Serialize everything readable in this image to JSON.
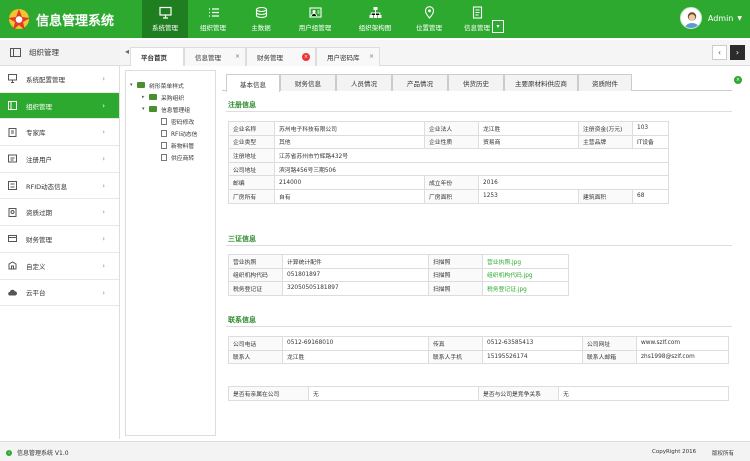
{
  "app": {
    "title": "信息管理系统",
    "brand_color": "#2ea92f"
  },
  "topnav": [
    {
      "label": "系统管理",
      "icon": "monitor-icon",
      "active": true
    },
    {
      "label": "组织管理",
      "icon": "list-icon"
    },
    {
      "label": "主数据",
      "icon": "coin-icon"
    },
    {
      "label": "用户组管理",
      "icon": "user-group-icon"
    },
    {
      "label": "组织架构图",
      "icon": "org-chart-icon"
    },
    {
      "label": "位置管理",
      "icon": "location-icon"
    },
    {
      "label": "信息管理",
      "icon": "document-icon"
    }
  ],
  "user": {
    "name": "Admin"
  },
  "sidebar": {
    "header": "组织管理",
    "items": [
      {
        "label": "系统配置管理",
        "icon": "monitor-icon"
      },
      {
        "label": "组织管理",
        "icon": "users-icon",
        "active": true
      },
      {
        "label": "专家库",
        "icon": "book-icon"
      },
      {
        "label": "注册用户",
        "icon": "register-icon"
      },
      {
        "label": "RFID动态信息",
        "icon": "rfid-icon"
      },
      {
        "label": "资质过期",
        "icon": "certificate-icon"
      },
      {
        "label": "财务管理",
        "icon": "finance-icon"
      },
      {
        "label": "自定义",
        "icon": "custom-icon"
      },
      {
        "label": "云平台",
        "icon": "cloud-icon"
      }
    ]
  },
  "pagetabs": [
    {
      "label": "平台首页",
      "active": true
    },
    {
      "label": "信息管理",
      "close": "x"
    },
    {
      "label": "财务管理",
      "close": "dot"
    },
    {
      "label": "用户密码库",
      "close": "x"
    }
  ],
  "tree": [
    {
      "label": "树形菜单样式",
      "level": 0,
      "type": "folder",
      "caret": "▾"
    },
    {
      "label": "采购组织",
      "level": 1,
      "type": "folder",
      "caret": "▸"
    },
    {
      "label": "信息管理组",
      "level": 1,
      "type": "folder",
      "caret": "▾"
    },
    {
      "label": "密码修改",
      "level": 2,
      "type": "file"
    },
    {
      "label": "RFI动态信",
      "level": 2,
      "type": "file"
    },
    {
      "label": "新物料管",
      "level": 2,
      "type": "file"
    },
    {
      "label": "供应商转",
      "level": 2,
      "type": "file"
    }
  ],
  "content_tabs": [
    {
      "label": "基本信息",
      "active": true
    },
    {
      "label": "财务信息"
    },
    {
      "label": "人员情况"
    },
    {
      "label": "产品情况"
    },
    {
      "label": "供货历史"
    },
    {
      "label": "主要原材料供应商"
    },
    {
      "label": "资质附件"
    }
  ],
  "sections": {
    "register": {
      "title": "注册信息",
      "rows": [
        [
          "企业名称",
          "苏州电子科技有限公司",
          "企业法人",
          "龙江胜",
          "注册资金(万元)",
          "103"
        ],
        [
          "企业类型",
          "其他",
          "企业性质",
          "贸易商",
          "主营品牌",
          "IT设备"
        ],
        [
          "注册地址",
          "江苏省苏州市竹辉路432号"
        ],
        [
          "公司地址",
          "滨河路456号三期506"
        ],
        [
          "邮编",
          "214000",
          "成立年份",
          "2016"
        ],
        [
          "厂房所有",
          "自有",
          "厂房面积",
          "1253",
          "建筑面积",
          "68"
        ]
      ]
    },
    "certs": {
      "title": "三证信息",
      "rows": [
        [
          "营业执照",
          "计算统计配件",
          "扫描照",
          "营业执照.jpg"
        ],
        [
          "组织机构代码",
          "051801897",
          "扫描照",
          "组织机构代码.jpg"
        ],
        [
          "税务登记证",
          "32050505181897",
          "扫描照",
          "税务登记证.jpg"
        ]
      ]
    },
    "contact": {
      "title": "联系信息",
      "rows": [
        [
          "公司电话",
          "0512-69168010",
          "传真",
          "0512-63585413",
          "公司网址",
          "www.szlf.com"
        ],
        [
          "联系人",
          "龙江胜",
          "联系人手机",
          "15195526174",
          "联系人邮箱",
          "zhs1998@szlf.com"
        ]
      ]
    },
    "relation": {
      "row": [
        "是否有亲属在公司",
        "无",
        "是否与公司是竞争关系",
        "无"
      ]
    }
  },
  "footer": {
    "app": "信息管理系统 V1.0",
    "copyright": "CopyRight 2016",
    "rights": "版权所有"
  }
}
